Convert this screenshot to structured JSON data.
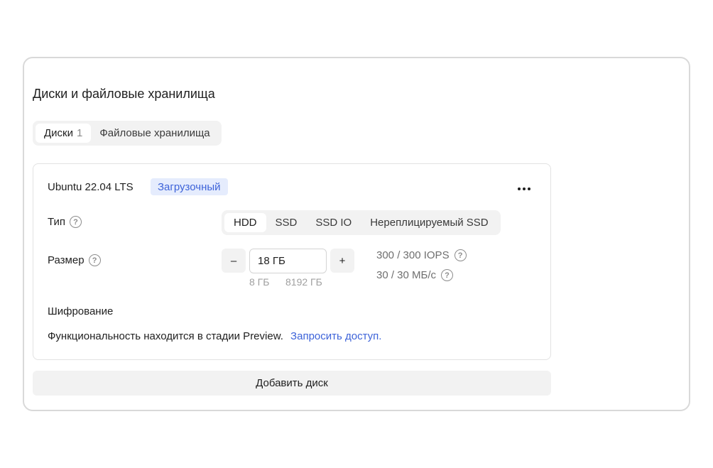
{
  "section": {
    "title": "Диски и файловые хранилища"
  },
  "tabs": [
    {
      "label": "Диски",
      "count": "1"
    },
    {
      "label": "Файловые хранилища"
    }
  ],
  "disk": {
    "name": "Ubuntu 22.04 LTS",
    "badge": "Загрузочный",
    "more_icon": "more-horizontal-icon",
    "type": {
      "label": "Тип",
      "options": [
        "HDD",
        "SSD",
        "SSD IO",
        "Нереплицируемый SSD"
      ],
      "selected": "HDD"
    },
    "size": {
      "label": "Размер",
      "minus": "–",
      "plus": "+",
      "value": "18 ГБ",
      "min": "8 ГБ",
      "max": "8192 ГБ"
    },
    "perf": {
      "iops": "300 / 300 IOPS",
      "throughput": "30 / 30 МБ/с"
    },
    "encryption": {
      "title": "Шифрование",
      "text": "Функциональность находится в стадии Preview.",
      "link": "Запросить доступ."
    }
  },
  "add_disk_label": "Добавить диск",
  "help_glyph": "?",
  "colors": {
    "accent": "#3d63d9",
    "badge_bg": "#e5ecfd",
    "surface": "#f2f2f2"
  }
}
